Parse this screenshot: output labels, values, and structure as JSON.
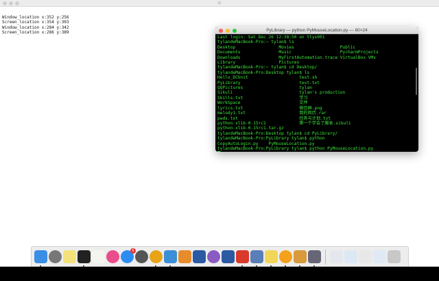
{
  "tk_window": {
    "title": "tk",
    "output": [
      "Window_location x:352 y:256",
      "Screen_location x:354 y:303",
      "Window_location x:284 y:342",
      "Screen_location x:286 y:389"
    ]
  },
  "terminal": {
    "title": "PyLibrary — python PyMouseLocation.py — 80×24",
    "lines": [
      "Last login: Sat Dec 26 12:38:50 on ttys001",
      "tylandeMacBook-Pro:~ tylan$ ls",
      "Desktop                 Movies                  Public",
      "Documents               Music                   PycharmProjects",
      "Downloads               MyFirstAutomation.trace VirtualBox VMs",
      "Library                 Pictures",
      "tylandeMacBook-Pro:~ tylan$ cd Desktop/",
      "tylandeMacBook-Pro:Desktop tylan$ ls",
      "Hello_DCUnit                    test.sh",
      "PyLibrary                       test.txt",
      "QQPictures                      tylan",
      "Sikuli                          tylan's production",
      "Skills.txt                      学习",
      "WorkSpace                       文件",
      "lyrics.txt                      微信群.png",
      "melody1.txt                     我的简历.rar",
      "pwds.txt                        任务与计划.txt",
      "python-xlib-0.15rc1             第一个学会了脚本.sikuli",
      "python-xlib-0.15rc1.tar.gz",
      "tylandeMacBook-Pro:Desktop tylan$ cd PyLibrary/",
      "tylandeMacBook-Pro:PyLibrary tylan$ python",
      "CopyAutoLogin.py    PyMouseLocation.py",
      "tylandeMacBook-Pro:PyLibrary tylan$ python PyMouseLocation.py"
    ]
  },
  "dock": {
    "items": [
      {
        "name": "finder",
        "color": "#3a8ee6",
        "run": true
      },
      {
        "name": "launchpad",
        "color": "#777",
        "round": true
      },
      {
        "name": "stickies",
        "color": "#f3e27a"
      },
      {
        "name": "terminal",
        "color": "#222",
        "run": true
      },
      {
        "name": "textedit",
        "color": "#f5f5f0"
      },
      {
        "name": "itunes",
        "color": "#e94d8a",
        "round": true
      },
      {
        "name": "app-store",
        "color": "#2d8cf0",
        "round": true,
        "badge": "6"
      },
      {
        "name": "system-preferences",
        "color": "#555",
        "round": true
      },
      {
        "name": "chrome",
        "color": "#e8a317",
        "round": true,
        "run": true
      },
      {
        "name": "xcode",
        "color": "#3b8fd6",
        "run": true
      },
      {
        "name": "sublime",
        "color": "#e88b2c"
      },
      {
        "name": "virtualbox",
        "color": "#2b5aa3"
      },
      {
        "name": "vm-orb",
        "color": "#8a5bc2",
        "round": true
      },
      {
        "name": "virtualbox-2",
        "color": "#2b5aa3"
      },
      {
        "name": "qq",
        "color": "#d93a2b",
        "run": true
      },
      {
        "name": "remote-desktop",
        "color": "#5a7fb8",
        "run": true
      },
      {
        "name": "notes-folder",
        "color": "#f2d65a",
        "run": true
      },
      {
        "name": "sun-app",
        "color": "#f4a11c",
        "round": true,
        "run": true
      },
      {
        "name": "scissors-tool",
        "color": "#d89a3a",
        "run": true
      },
      {
        "name": "rocket-app",
        "color": "#667",
        "run": true
      },
      {
        "sep": true
      },
      {
        "name": "document",
        "color": "#e4e8ee"
      },
      {
        "name": "download-folder",
        "color": "#dde8f5"
      },
      {
        "name": "screenshot-doc",
        "color": "#e8e8e8"
      },
      {
        "name": "downloads-stack",
        "color": "#dfeaf6"
      },
      {
        "name": "trash",
        "color": "#c8c8c8"
      }
    ]
  }
}
